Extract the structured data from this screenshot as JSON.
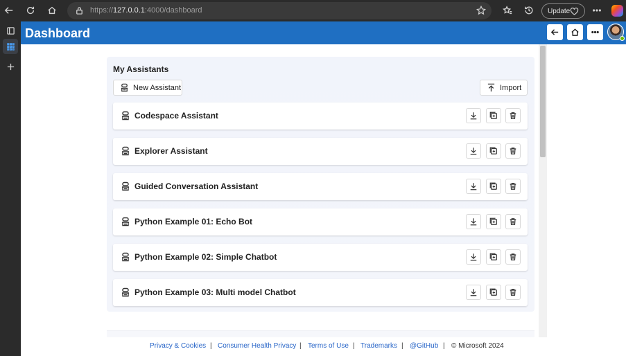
{
  "browser": {
    "url_prefix": "https://",
    "url_host": "127.0.0.1",
    "url_rest": ":4000/dashboard",
    "update_label": "Update"
  },
  "app": {
    "title": "Dashboard"
  },
  "assistants": {
    "section_title": "My Assistants",
    "new_label": "New Assistant",
    "import_label": "Import",
    "items": [
      {
        "name": "Codespace Assistant"
      },
      {
        "name": "Explorer Assistant"
      },
      {
        "name": "Guided Conversation Assistant"
      },
      {
        "name": "Python Example 01: Echo Bot"
      },
      {
        "name": "Python Example 02: Simple Chatbot"
      },
      {
        "name": "Python Example 03: Multi model Chatbot"
      }
    ]
  },
  "footer": {
    "links": [
      "Privacy & Cookies",
      "Consumer Health Privacy",
      "Terms of Use",
      "Trademarks",
      "@GitHub"
    ],
    "separator": "|",
    "copyright": "© Microsoft 2024"
  },
  "colors": {
    "header": "#1f6fc2",
    "link": "#2966c8"
  }
}
